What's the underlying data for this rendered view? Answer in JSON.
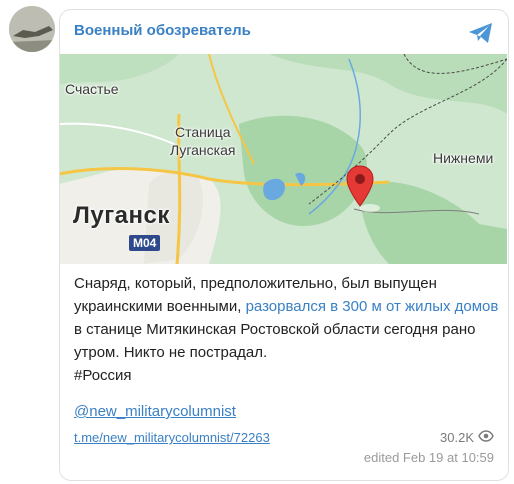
{
  "channel": {
    "name": "Военный обозреватель",
    "icon": "telegram-icon"
  },
  "map": {
    "labels": {
      "schastye": "Счастье",
      "stanitsa_1": "Станица",
      "stanitsa_2": "Луганская",
      "lugansk": "Луганск",
      "nizhnemi": "Нижнеми",
      "road": "M04"
    },
    "pin_icon": "location-pin-icon",
    "colors": {
      "land": "#cfe7cf",
      "urban": "#f0efe9",
      "forest": "#a8d5a8",
      "water": "#6aa9e0",
      "road": "#f5c646",
      "pin": "#e53935"
    }
  },
  "post": {
    "text_before": "Снаряд, который, предположительно, был выпущен украинскими военными, ",
    "text_link": "разорвался в 300 м от жилых домов",
    "text_after": " в станице Митякинская Ростовской области сегодня рано утром. Никто не пострадал.",
    "hashtag": "#Россия",
    "handle": "@new_militarycolumnist",
    "url": "t.me/new_militarycolumnist/72263",
    "views": "30.2K",
    "views_icon": "eye-icon",
    "edited": "edited  Feb 19 at 10:59"
  },
  "colors": {
    "link": "#3a80c4",
    "text": "#222222",
    "muted": "#9a9a9a"
  }
}
